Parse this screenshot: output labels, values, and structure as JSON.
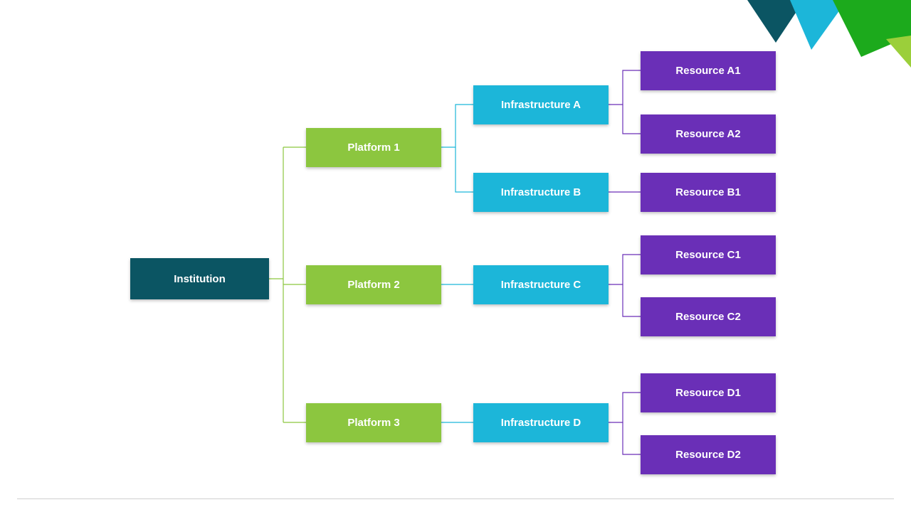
{
  "colors": {
    "institution": "#0b5563",
    "platform": "#8cc63f",
    "infrastructure": "#1cb6d9",
    "resource": "#6a2fb7",
    "corner_dark": "#0b5563",
    "corner_cyan": "#1cb6d9",
    "corner_green": "#1caa1c",
    "corner_lime": "#9bcf3a"
  },
  "tree": {
    "root": {
      "label": "Institution"
    },
    "platforms": [
      {
        "label": "Platform 1",
        "infrastructures": [
          {
            "label": "Infrastructure A",
            "resources": [
              {
                "label": "Resource A1"
              },
              {
                "label": "Resource A2"
              }
            ]
          },
          {
            "label": "Infrastructure B",
            "resources": [
              {
                "label": "Resource B1"
              }
            ]
          }
        ]
      },
      {
        "label": "Platform 2",
        "infrastructures": [
          {
            "label": "Infrastructure C",
            "resources": [
              {
                "label": "Resource C1"
              },
              {
                "label": "Resource C2"
              }
            ]
          }
        ]
      },
      {
        "label": "Platform 3",
        "infrastructures": [
          {
            "label": "Infrastructure D",
            "resources": [
              {
                "label": "Resource D1"
              },
              {
                "label": "Resource D2"
              }
            ]
          }
        ]
      }
    ]
  }
}
